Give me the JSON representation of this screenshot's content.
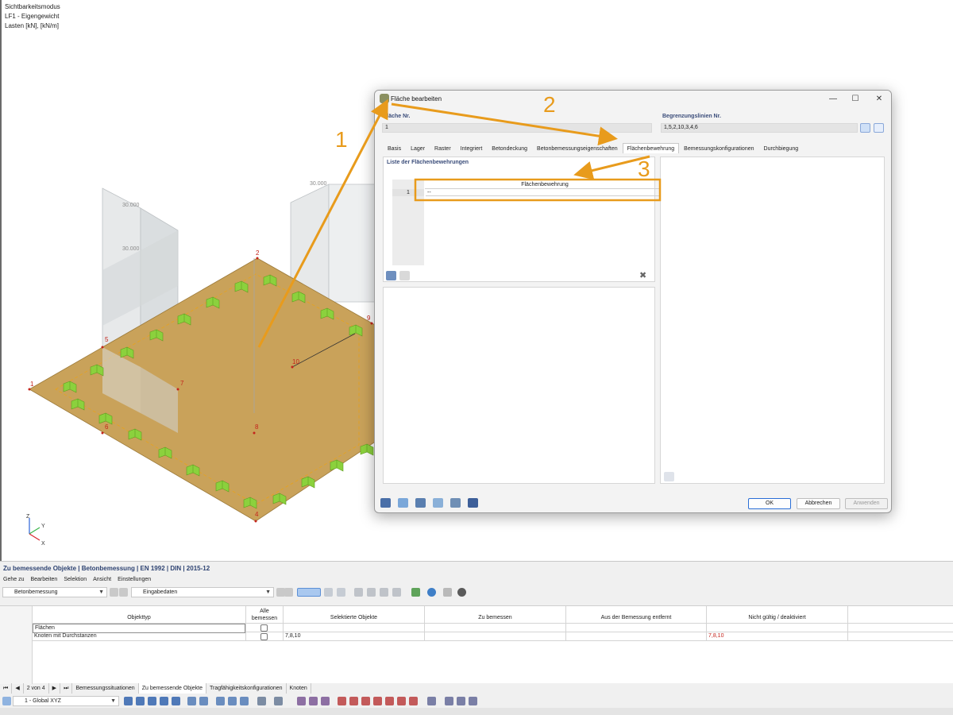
{
  "viewport": {
    "info": [
      "Sichtbarkeitsmodus",
      "LF1 - Eigengewicht",
      "Lasten [kN], [kN/m]"
    ],
    "node_labels": [
      "1",
      "2",
      "4",
      "5",
      "6",
      "7",
      "8",
      "9",
      "10"
    ],
    "dim_labels": [
      "30.000",
      "30.000",
      "30.000"
    ],
    "axis_labels": {
      "z": "Z",
      "y": "Y",
      "x": "X"
    },
    "annotations": [
      "1",
      "2",
      "3"
    ],
    "colors": {
      "surface": "#c9a25a",
      "support": "#8bd13d",
      "annotation": "#e89b1c",
      "node": "#c4241c"
    }
  },
  "dialog": {
    "title": "Fläche bearbeiten",
    "surface_no_label": "Fläche Nr.",
    "surface_no_value": "1",
    "boundary_label": "Begrenzungslinien Nr.",
    "boundary_value": "1,5,2,10,3,4,6",
    "tabs": [
      "Basis",
      "Lager",
      "Raster",
      "Integriert",
      "Betondeckung",
      "Betonbemessungseigenschaften",
      "Flächenbewehrung",
      "Bemessungskonfigurationen",
      "Durchbiegung"
    ],
    "active_tab": "Flächenbewehrung",
    "list_title": "Liste der Flächenbewehrungen",
    "table_header": "Flächenbewehrung",
    "table_row_num": "1",
    "table_row_value": "--",
    "buttons": {
      "ok": "OK",
      "cancel": "Abbrechen",
      "apply": "Anwenden"
    }
  },
  "bottom_panel": {
    "title": "Zu bemessende Objekte | Betonbemessung | EN 1992 | DIN | 2015-12",
    "menu": [
      "Gehe zu",
      "Bearbeiten",
      "Selektion",
      "Ansicht",
      "Einstellungen"
    ],
    "module_combo": "Betonbemessung",
    "data_combo": "Eingabedaten",
    "columns": [
      "Objekttyp",
      "Alle bemessen",
      "Selektierte Objekte",
      "Zu bemessen",
      "Aus der Bemessung entfernt",
      "Nicht gültig / deaktiviert"
    ],
    "rows": [
      {
        "type": "Flächen",
        "selected": "",
        "to_design": "",
        "removed": "",
        "invalid": ""
      },
      {
        "type": "Knoten mit Durchstanzen",
        "selected": "7,8,10",
        "to_design": "",
        "removed": "",
        "invalid": "7,8,10"
      }
    ],
    "pager": "2 von 4",
    "tabs": [
      "Bemessungssituationen",
      "Zu bemessende Objekte",
      "Tragfähigkeitskonfigurationen",
      "Knoten"
    ],
    "active_tab": "Zu bemessende Objekte",
    "coord_system": "1 - Global XYZ"
  }
}
